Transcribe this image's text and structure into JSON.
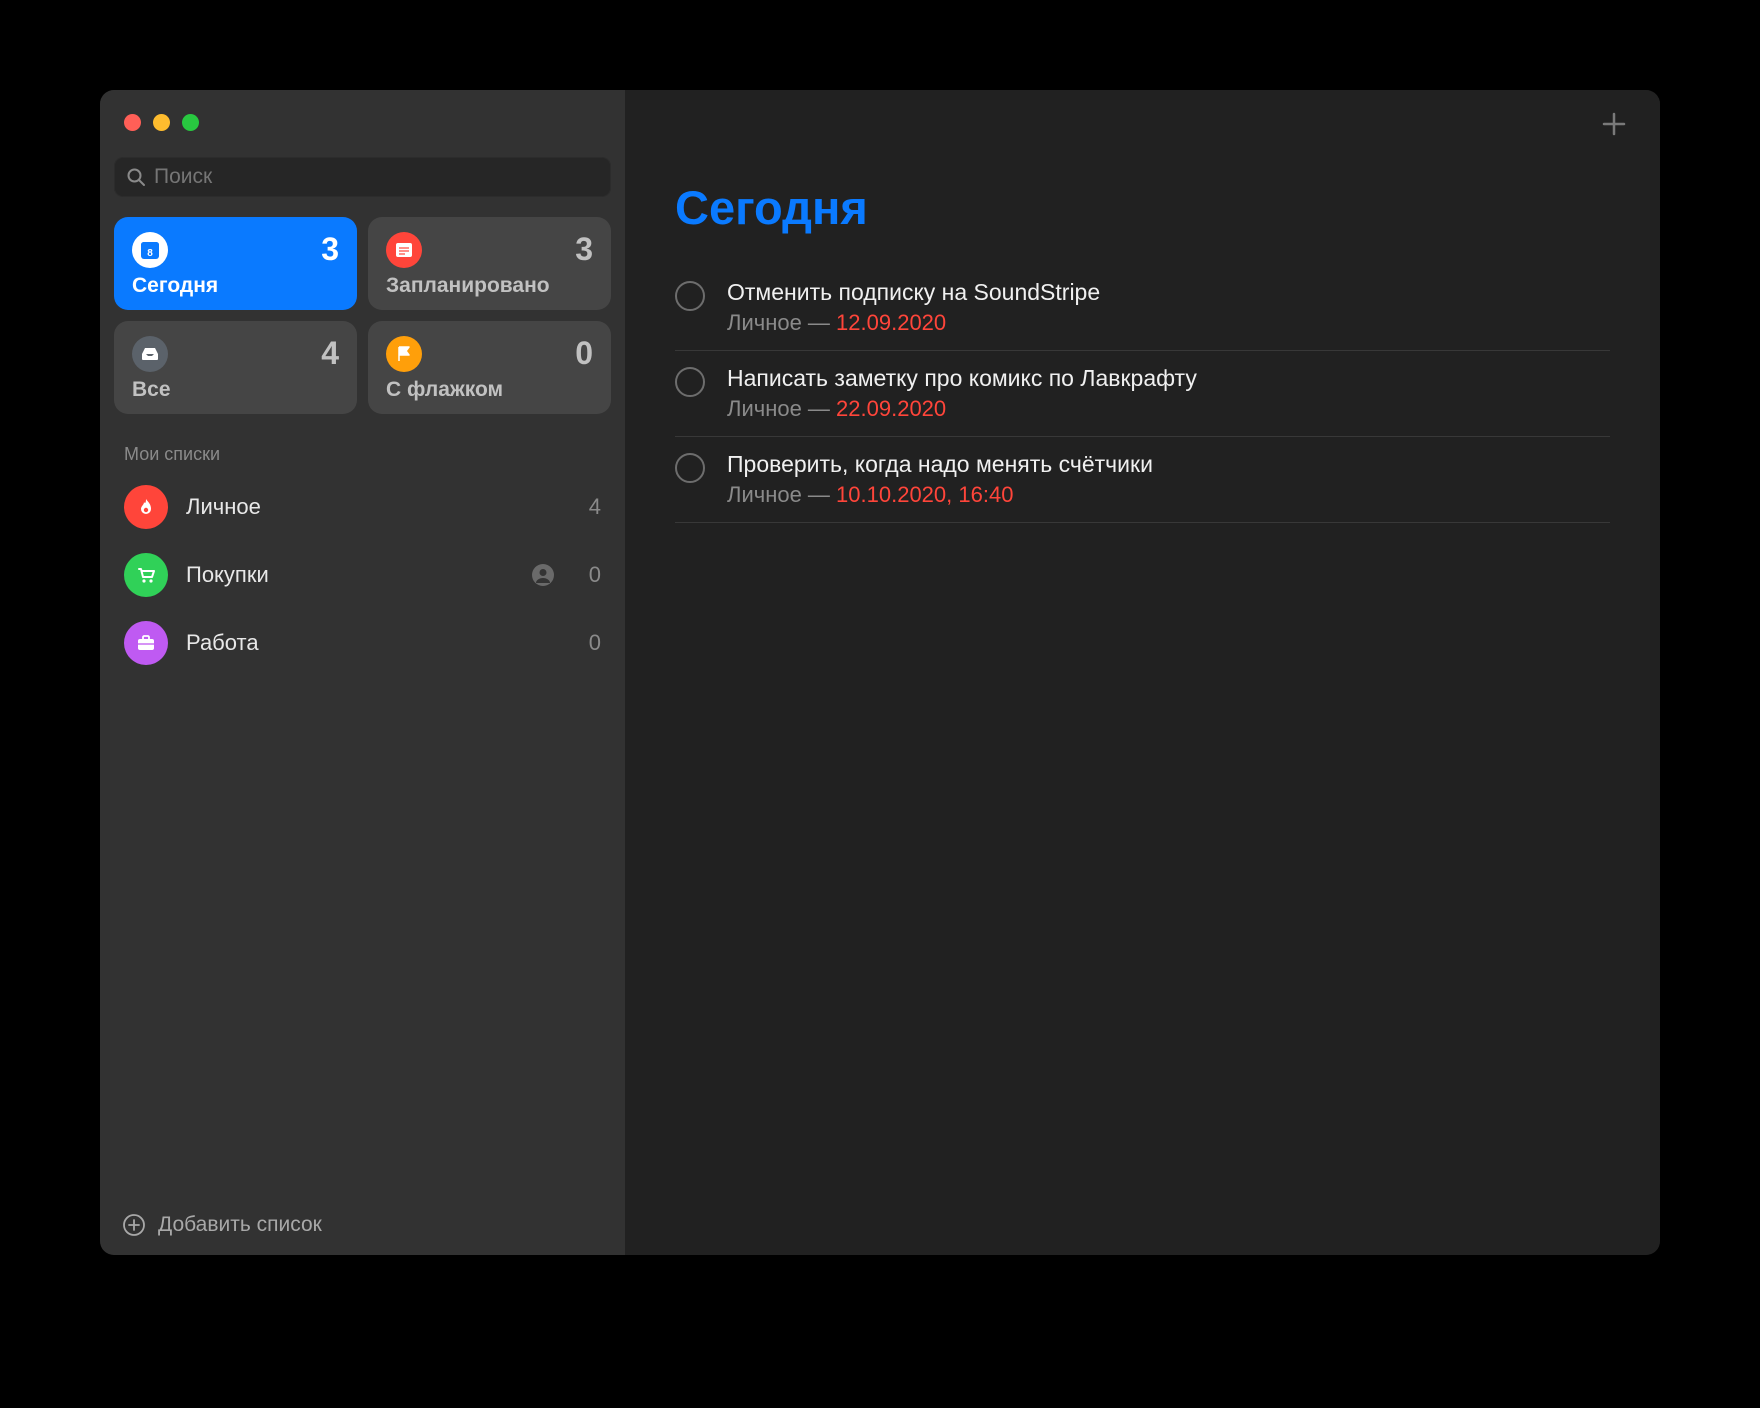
{
  "sidebar": {
    "search_placeholder": "Поиск",
    "smart": [
      {
        "label": "Сегодня",
        "count": 3,
        "active": true,
        "icon": "calendar-today",
        "color": "#fff",
        "bg": "#0a7aff"
      },
      {
        "label": "Запланировано",
        "count": 3,
        "active": false,
        "icon": "calendar",
        "color": "#fff",
        "bg": "#ff453a"
      },
      {
        "label": "Все",
        "count": 4,
        "active": false,
        "icon": "tray",
        "color": "#fff",
        "bg": "#5b626a"
      },
      {
        "label": "С флажком",
        "count": 0,
        "active": false,
        "icon": "flag",
        "color": "#fff",
        "bg": "#ff9f0a"
      }
    ],
    "lists_header": "Мои списки",
    "lists": [
      {
        "name": "Личное",
        "count": 4,
        "color": "#ff453a",
        "icon": "flame",
        "shared": false
      },
      {
        "name": "Покупки",
        "count": 0,
        "color": "#30d158",
        "icon": "cart",
        "shared": true
      },
      {
        "name": "Работа",
        "count": 0,
        "color": "#bf5af2",
        "icon": "briefcase",
        "shared": false
      }
    ],
    "add_list_label": "Добавить список"
  },
  "main": {
    "title": "Сегодня",
    "reminders": [
      {
        "title": "Отменить подписку на SoundStripe",
        "list": "Личное",
        "date": "12.09.2020"
      },
      {
        "title": "Написать заметку про комикс по Лавкрафту",
        "list": "Личное",
        "date": "22.09.2020"
      },
      {
        "title": "Проверить, когда надо менять счётчики",
        "list": "Личное",
        "date": "10.10.2020, 16:40"
      }
    ]
  }
}
